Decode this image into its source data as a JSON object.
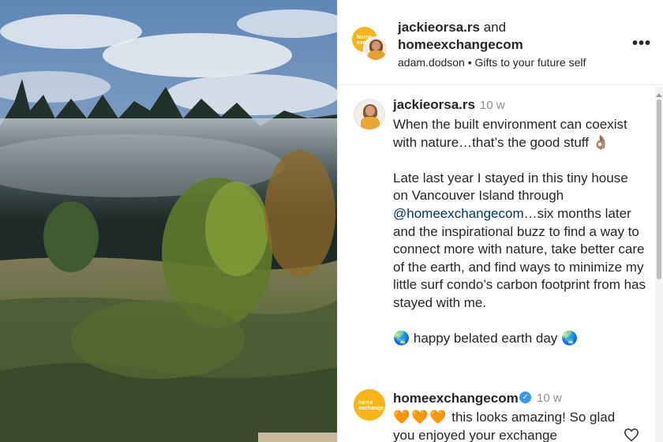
{
  "header": {
    "user1": "jackieorsa.rs",
    "joiner": "and",
    "user2": "homeexchangecom",
    "subline": "adam.dodson • Gifts to your future self",
    "more_icon": "more-horizontal-icon",
    "brand_badge_text": "home exchange"
  },
  "caption": {
    "username": "jackieorsa.rs",
    "time": "10 w",
    "line1": "When the built environment can coexist with nature…that’s the good stuff 👌🏽",
    "para2_before": "Late last year I stayed in this tiny house on Vancouver Island through ",
    "mention": "@homeexchangecom",
    "para2_after": "…six months later and the inspirational buzz to find a way to connect more with nature, take better care of the earth, and find ways to minimize my little surf condo’s carbon footprint from has stayed with me.",
    "line3": "🌏 happy belated earth day 🌏"
  },
  "reply": {
    "username": "homeexchangecom",
    "time": "10 w",
    "hearts": "🧡🧡🧡",
    "text": " this looks amazing! So glad you enjoyed your exchange",
    "brand_badge_text": "home exchange"
  },
  "colors": {
    "brand_yellow": "#f6b51b",
    "link": "#00376b",
    "muted": "#8e8e8e",
    "verified": "#3897f0"
  }
}
